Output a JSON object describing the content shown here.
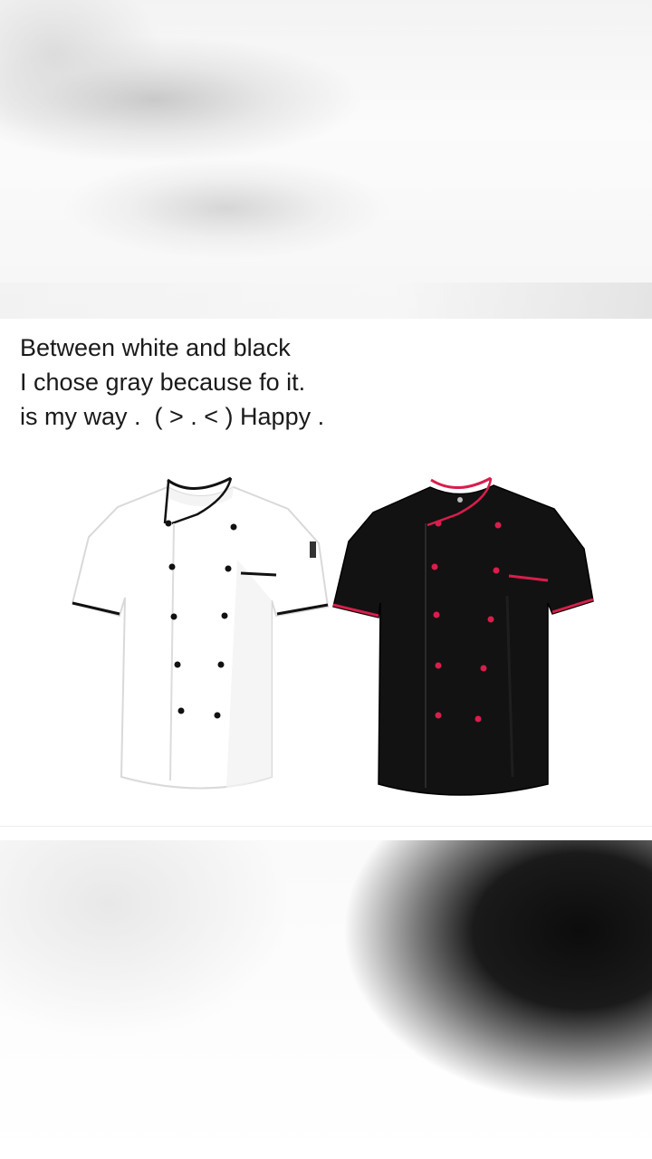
{
  "post": {
    "caption_lines": [
      "Between white and black",
      "I chose gray because fo it.",
      "is my way .  ( > . < ) Happy ."
    ]
  },
  "photo": {
    "subject": "chef-jackets",
    "items": [
      {
        "name": "white-chef-jacket",
        "body_color": "#ffffff",
        "trim_color": "#111111",
        "button_color": "#111111"
      },
      {
        "name": "black-chef-jacket",
        "body_color": "#121212",
        "trim_color": "#d81e4b",
        "button_color": "#d81e4b"
      }
    ]
  }
}
